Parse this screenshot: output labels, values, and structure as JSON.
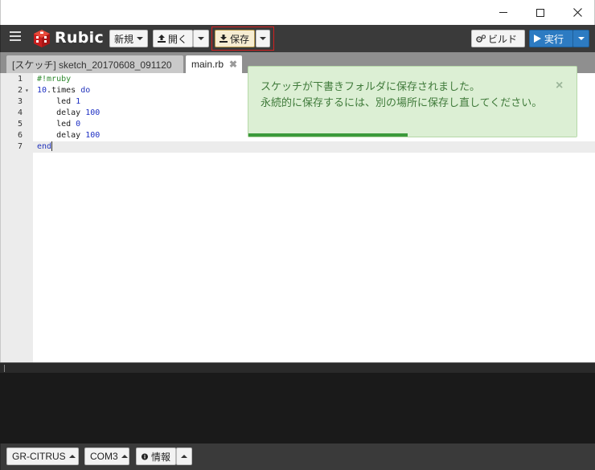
{
  "window": {
    "minimize_glyph": "—",
    "maximize_glyph": "☐",
    "close_glyph": "✕"
  },
  "app": {
    "logo_text": "Rubic",
    "brand_color": "#d42020"
  },
  "toolbar": {
    "new_label": "新規",
    "open_label": "開く",
    "save_label": "保存",
    "build_label": "ビルド",
    "run_label": "実行",
    "run_color": "#2d7bc2"
  },
  "tabs": [
    {
      "label": "[スケッチ] sketch_20170608_091120",
      "active": false
    },
    {
      "label": "main.rb",
      "active": true,
      "close_glyph": "✖"
    }
  ],
  "editor": {
    "language": "ruby",
    "active_line": 7,
    "lines": [
      {
        "num": "1",
        "fold": ""
      },
      {
        "num": "2",
        "fold": "▾"
      },
      {
        "num": "3",
        "fold": ""
      },
      {
        "num": "4",
        "fold": ""
      },
      {
        "num": "5",
        "fold": ""
      },
      {
        "num": "6",
        "fold": ""
      },
      {
        "num": "7",
        "fold": ""
      }
    ],
    "tokens": {
      "l1": "#!mruby",
      "l2_num": "10",
      "l2_mid": ".times ",
      "l2_kw": "do",
      "l3_fn": "    led ",
      "l3_num": "1",
      "l4_fn": "    delay ",
      "l4_num": "100",
      "l5_fn": "    led ",
      "l5_num": "0",
      "l6_fn": "    delay ",
      "l6_num": "100",
      "l7_kw": "end"
    }
  },
  "notification": {
    "line1": "スケッチが下書きフォルダに保存されました。",
    "line2": "永続的に保存するには、別の場所に保存し直してください。",
    "close_glyph": "×",
    "progress": 0.485,
    "color": "#3b9a3b"
  },
  "statusbar": {
    "board_label": "GR-CITRUS",
    "port_label": "COM3",
    "info_label": "情報"
  },
  "icons": [
    "menu-icon",
    "rubic-logo-icon",
    "upload-icon",
    "download-icon",
    "gears-icon",
    "play-icon",
    "info-icon"
  ]
}
